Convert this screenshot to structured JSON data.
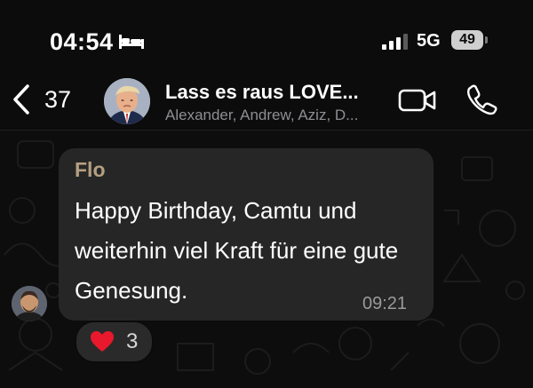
{
  "status_bar": {
    "time": "04:54",
    "network": "5G",
    "battery": "49",
    "icons": [
      "bed-icon",
      "signal-icon"
    ]
  },
  "header": {
    "back_count": "37",
    "title": "Lass es raus LOVE...",
    "subtitle": "Alexander, Andrew, Aziz, D...",
    "icons": [
      "back-chevron-icon",
      "video-call-icon",
      "phone-call-icon"
    ]
  },
  "message": {
    "sender": "Flo",
    "text": "Happy Birthday, Camtu und weiterhin viel Kraft für eine gute Genesung.",
    "time": "09:21",
    "sender_color": "#b59f82",
    "reaction": {
      "emoji": "❤️",
      "count": "3"
    }
  },
  "colors": {
    "background": "#0b0b0b",
    "bubble": "#262626",
    "text": "#ffffff",
    "muted": "#8e8e93"
  }
}
